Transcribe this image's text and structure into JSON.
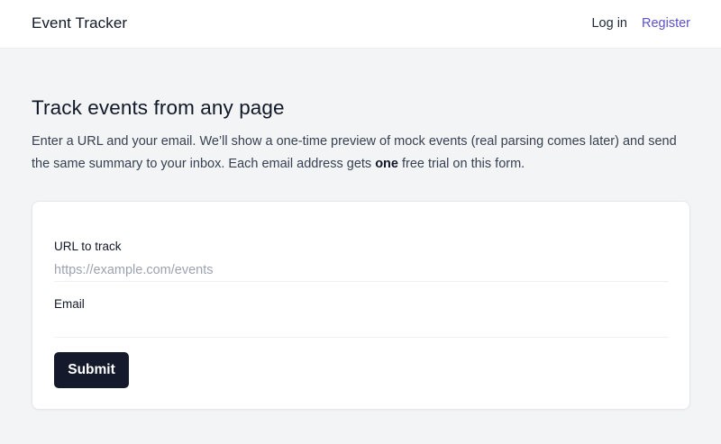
{
  "header": {
    "brand": "Event Tracker",
    "login_label": "Log in",
    "register_label": "Register"
  },
  "main": {
    "title": "Track events from any page",
    "intro_before_bold": "Enter a URL and your email. We’ll show a one-time preview of mock events (real parsing comes later) and send the same summary to your inbox. Each email address gets ",
    "intro_bold": "one",
    "intro_after_bold": " free trial on this form."
  },
  "form": {
    "url_label": "URL to track",
    "url_value": "",
    "url_placeholder": "https://example.com/events",
    "email_label": "Email",
    "email_value": "",
    "email_placeholder": "",
    "submit_label": "Submit"
  },
  "colors": {
    "background": "#f3f4f6",
    "register_link": "#5b52c9",
    "submit_button": "#141a2b"
  }
}
